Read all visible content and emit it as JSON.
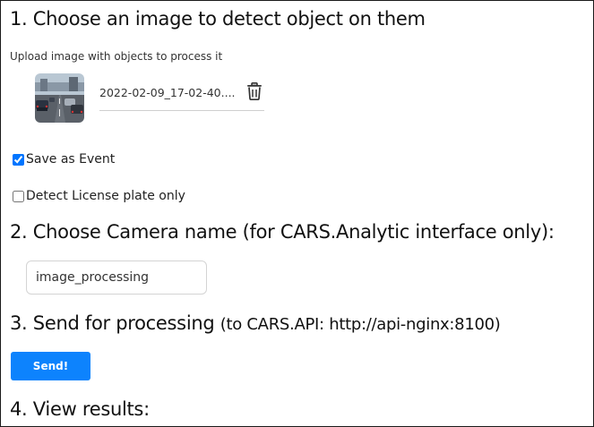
{
  "step1": {
    "title": "1. Choose an image to detect object on them",
    "subtitle": "Upload image with objects to process it",
    "file_name": "2022-02-09_17-02-40....",
    "thumbnail_icon": "road-traffic-thumbnail",
    "delete_icon": "trash-icon"
  },
  "options": {
    "save_as_event": {
      "label": "Save as Event",
      "checked": true
    },
    "license_plate_only": {
      "label": "Detect License plate only",
      "checked": false
    }
  },
  "step2": {
    "title": "2. Choose Camera name (for CARS.Analytic interface only):",
    "camera_name_value": "image_processing"
  },
  "step3": {
    "title": "3. Send for processing",
    "api_note": "(to CARS.API: http://api-nginx:8100)",
    "send_label": "Send!"
  },
  "step4": {
    "title": "4. View results:"
  },
  "colors": {
    "accent": "#0d83fd",
    "text": "#111111",
    "border": "#1a1a1a"
  }
}
